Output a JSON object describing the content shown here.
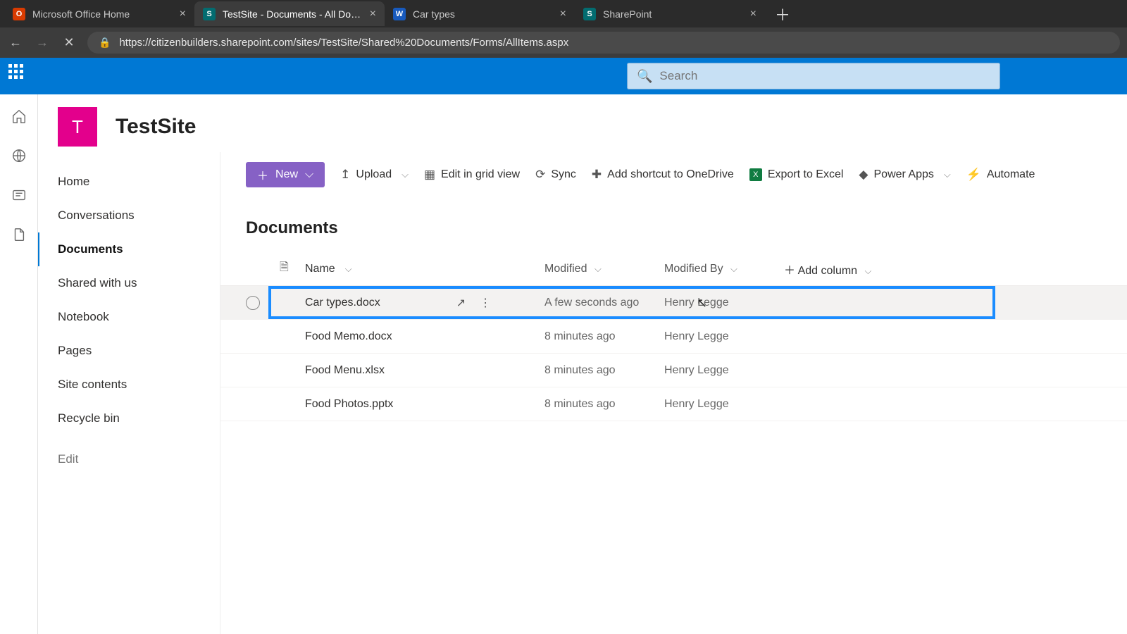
{
  "browser": {
    "tabs": [
      {
        "title": "Microsoft Office Home",
        "favicon": "O"
      },
      {
        "title": "TestSite - Documents - All Docum",
        "favicon": "S"
      },
      {
        "title": "Car types",
        "favicon": "W"
      },
      {
        "title": "SharePoint",
        "favicon": "S"
      }
    ],
    "active_tab_index": 1,
    "url": "https://citizenbuilders.sharepoint.com/sites/TestSite/Shared%20Documents/Forms/AllItems.aspx"
  },
  "search": {
    "placeholder": "Search"
  },
  "site": {
    "title": "TestSite",
    "logo_letter": "T"
  },
  "nav": {
    "items": [
      "Home",
      "Conversations",
      "Documents",
      "Shared with us",
      "Notebook",
      "Pages",
      "Site contents",
      "Recycle bin"
    ],
    "selected_index": 2,
    "edit_label": "Edit"
  },
  "commands": {
    "new_label": "New",
    "items": [
      "Upload",
      "Edit in grid view",
      "Sync",
      "Add shortcut to OneDrive",
      "Export to Excel",
      "Power Apps",
      "Automate"
    ]
  },
  "library": {
    "title": "Documents",
    "columns": {
      "name": "Name",
      "modified": "Modified",
      "by": "Modified By",
      "add": "Add column"
    },
    "rows": [
      {
        "name": "Car types.docx",
        "modified": "A few seconds ago",
        "by": "Henry Legge"
      },
      {
        "name": "Food Memo.docx",
        "modified": "8 minutes ago",
        "by": "Henry Legge"
      },
      {
        "name": "Food Menu.xlsx",
        "modified": "8 minutes ago",
        "by": "Henry Legge"
      },
      {
        "name": "Food Photos.pptx",
        "modified": "8 minutes ago",
        "by": "Henry Legge"
      }
    ]
  }
}
